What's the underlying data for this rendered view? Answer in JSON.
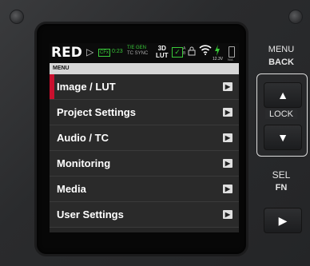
{
  "status_bar": {
    "logo": "RED",
    "logo_arrow": "▷",
    "cfx_label": "CFx",
    "timecode": "0:23",
    "tg_line1": "T/E GEN",
    "tg_line2": "TC SYNC",
    "three_d_line1": "3D",
    "three_d_line2": "LUT",
    "check": "✓",
    "ab_line1": "A",
    "ab_line2": "B",
    "voltage": "12.3V",
    "na_label": "N/A"
  },
  "menu": {
    "header": "MENU",
    "items": [
      {
        "label": "Image / LUT",
        "selected": true
      },
      {
        "label": "Project Settings",
        "selected": false
      },
      {
        "label": "Audio / TC",
        "selected": false
      },
      {
        "label": "Monitoring",
        "selected": false
      },
      {
        "label": "Media",
        "selected": false
      },
      {
        "label": "User Settings",
        "selected": false
      }
    ],
    "arrow_glyph": "▶"
  },
  "hardware": {
    "menu_label": "MENU",
    "back_label": "BACK",
    "lock_label": "LOCK",
    "sel_label": "SEL",
    "fn_label": "FN",
    "up_glyph": "▲",
    "down_glyph": "▼",
    "play_glyph": "▶"
  },
  "colors": {
    "accent_red": "#c8102e",
    "status_green": "#39c939"
  }
}
